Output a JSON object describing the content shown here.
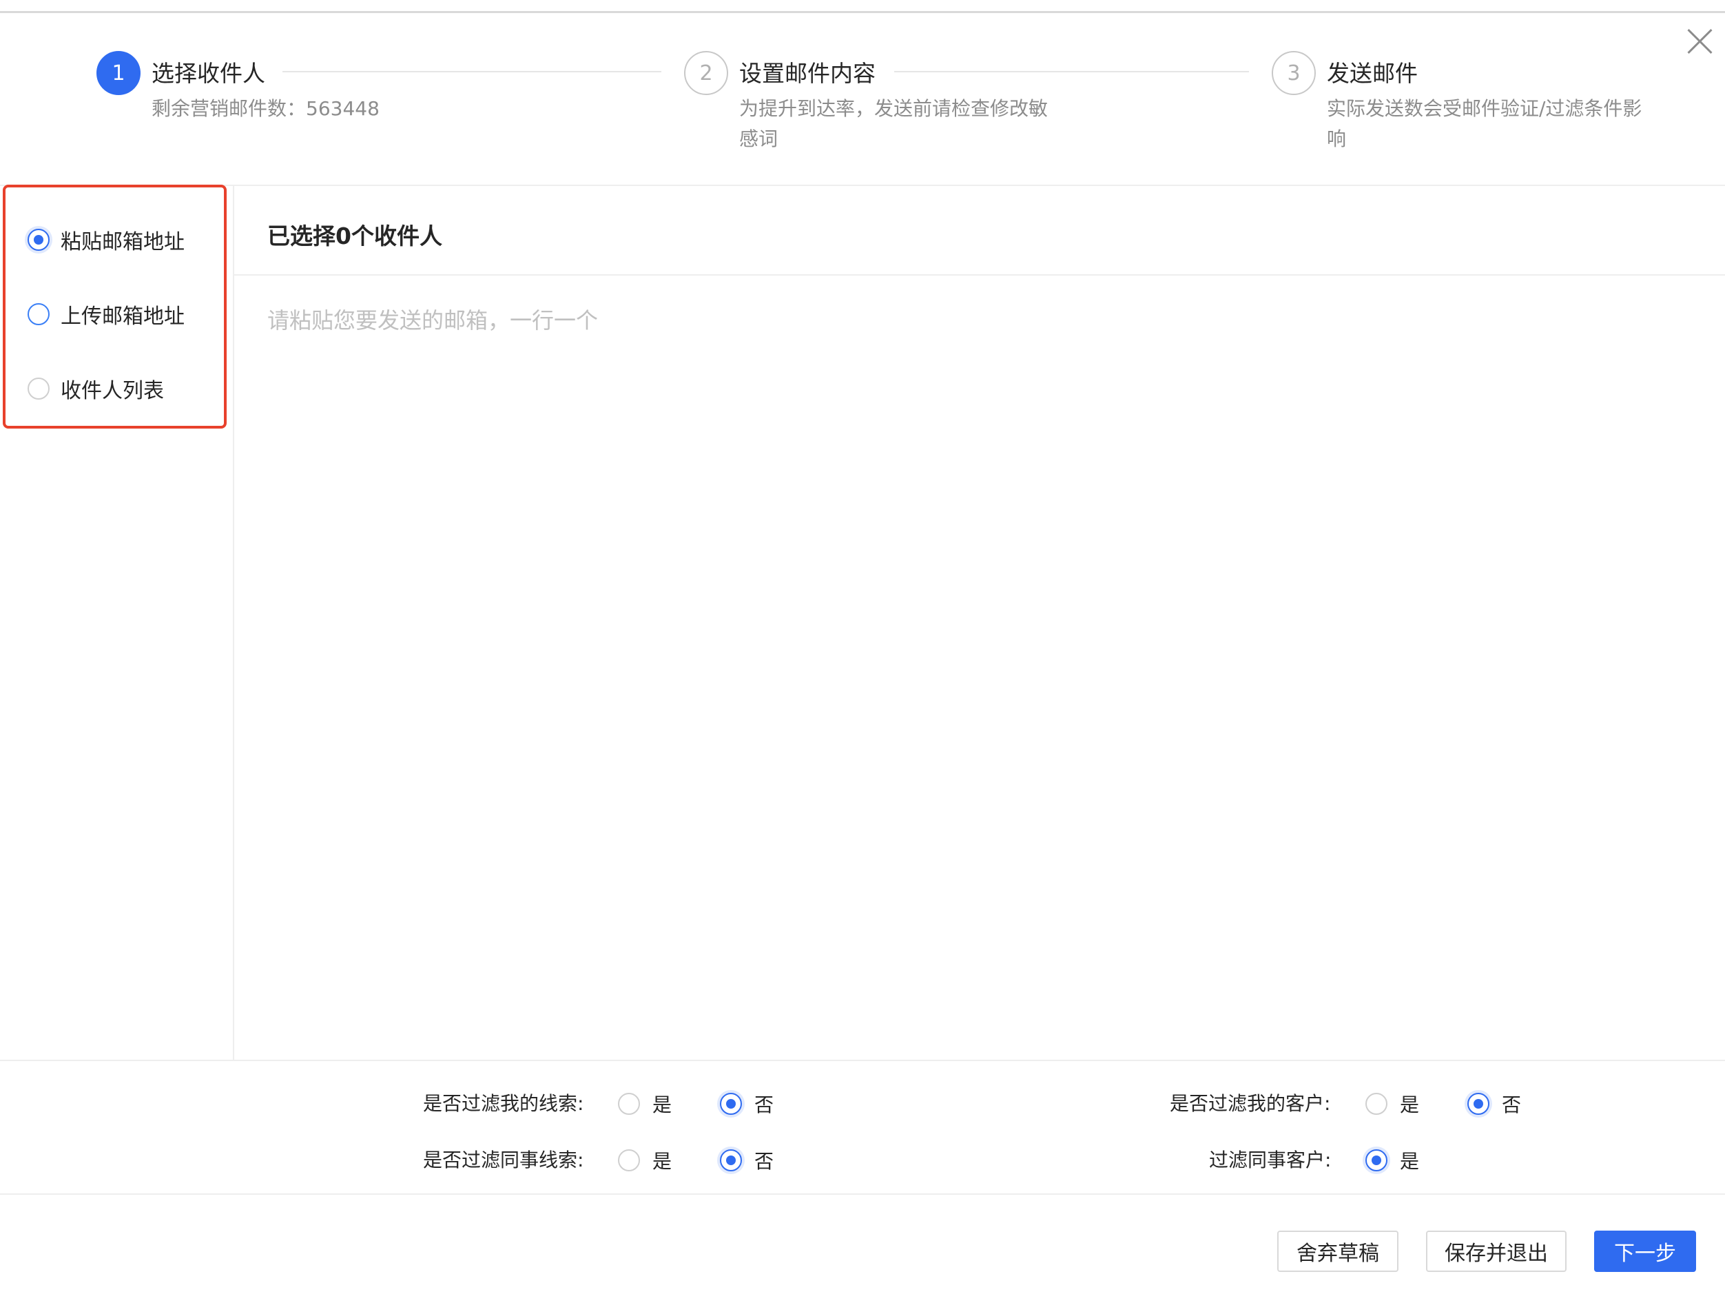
{
  "steps": [
    {
      "number": "1",
      "title": "选择收件人",
      "desc": "剩余营销邮件数：563448"
    },
    {
      "number": "2",
      "title": "设置邮件内容",
      "desc": "为提升到达率，发送前请检查修改敏感词"
    },
    {
      "number": "3",
      "title": "发送邮件",
      "desc": "实际发送数会受邮件验证/过滤条件影响"
    }
  ],
  "source_options": [
    {
      "label": "粘贴邮箱地址",
      "selected": true
    },
    {
      "label": "上传邮箱地址",
      "selected": false
    },
    {
      "label": "收件人列表",
      "selected": false
    }
  ],
  "main": {
    "selected_title": "已选择0个收件人",
    "textarea_placeholder": "请粘贴您要发送的邮箱，一行一个"
  },
  "filters": {
    "my_leads": {
      "label": "是否过滤我的线索:",
      "yes": "是",
      "no": "否",
      "value": "否"
    },
    "colleague_leads": {
      "label": "是否过滤同事线索:",
      "yes": "是",
      "no": "否",
      "value": "否"
    },
    "my_customers": {
      "label": "是否过滤我的客户:",
      "yes": "是",
      "no": "否",
      "value": "否"
    },
    "colleague_customers": {
      "label": "过滤同事客户:",
      "yes": "是",
      "value": "是"
    }
  },
  "footer": {
    "discard_label": "舍弃草稿",
    "save_exit_label": "保存并退出",
    "next_label": "下一步"
  },
  "colors": {
    "primary": "#2f6bf0",
    "highlight_border": "#e8412c"
  }
}
